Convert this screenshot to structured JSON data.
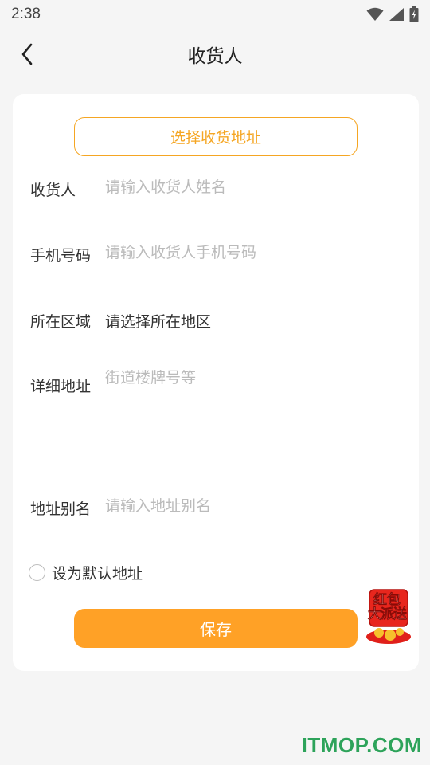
{
  "status_bar": {
    "time": "2:38",
    "icons": [
      "wifi-icon",
      "signal-icon",
      "battery-charging-icon"
    ]
  },
  "header": {
    "title": "收货人",
    "back_icon": "chevron-left-icon"
  },
  "form": {
    "choose_address_label": "选择收货地址",
    "fields": [
      {
        "label": "收货人",
        "value": "",
        "placeholder": "请输入收货人姓名"
      },
      {
        "label": "手机号码",
        "value": "",
        "placeholder": "请输入收货人手机号码"
      },
      {
        "label": "所在区域",
        "value": "请选择所在地区"
      },
      {
        "label": "详细地址",
        "value": "",
        "placeholder": "街道楼牌号等"
      },
      {
        "label": "地址别名",
        "value": "",
        "placeholder": "请输入地址别名"
      }
    ],
    "default_checkbox_label": "设为默认地址",
    "default_checked": false,
    "save_label": "保存"
  },
  "promo": {
    "line1": "红包",
    "line2": "大派送"
  },
  "watermark": "ITMOP.COM",
  "colors": {
    "accent": "#f5a623",
    "save_button": "#ffa126",
    "background": "#f5f5f5",
    "card": "#ffffff",
    "placeholder": "#bbbbbb",
    "watermark": "#2da35a"
  }
}
